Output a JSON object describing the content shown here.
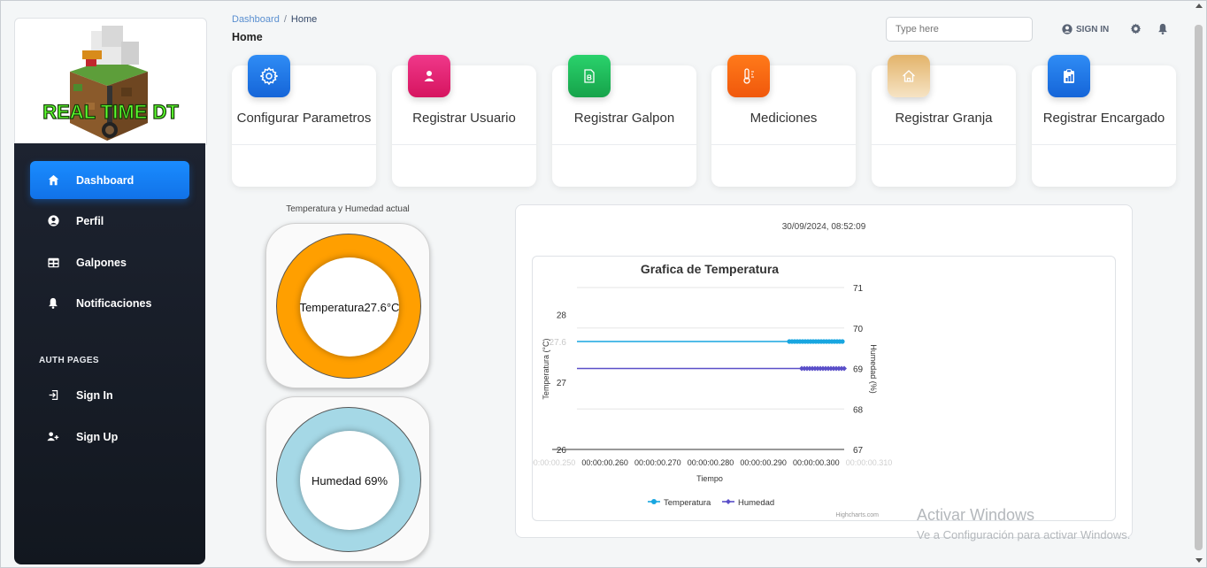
{
  "app": {
    "logo_text": "REAL TIME DT"
  },
  "breadcrumb": {
    "parent": "Dashboard",
    "separator": "/",
    "current": "Home"
  },
  "page_title": "Home",
  "search": {
    "placeholder": "Type here"
  },
  "topbar": {
    "signin_label": "SIGN IN",
    "icons": [
      "user-circle-icon",
      "gear-icon",
      "bell-icon"
    ]
  },
  "sidebar": {
    "items": [
      {
        "label": "Dashboard",
        "icon": "home-icon",
        "active": true
      },
      {
        "label": "Perfil",
        "icon": "user-circle-icon"
      },
      {
        "label": "Galpones",
        "icon": "table-icon"
      },
      {
        "label": "Notificaciones",
        "icon": "bell-icon"
      }
    ],
    "section_title": "AUTH PAGES",
    "auth_items": [
      {
        "label": "Sign In",
        "icon": "sign-in-icon"
      },
      {
        "label": "Sign Up",
        "icon": "user-plus-icon"
      }
    ]
  },
  "cards": [
    {
      "label": "Configurar Parametros",
      "icon": "gear-icon",
      "color": "#1a73e8"
    },
    {
      "label": "Registrar Usuario",
      "icon": "user-icon",
      "color": "#e91e63"
    },
    {
      "label": "Registrar Galpon",
      "icon": "document-icon",
      "color": "#1fb45a"
    },
    {
      "label": "Mediciones",
      "icon": "thermometer-icon",
      "color": "#fb6107"
    },
    {
      "label": "Registrar Granja",
      "icon": "house-icon",
      "color": "#d9a45a"
    },
    {
      "label": "Registrar Encargado",
      "icon": "clipboard-chart-icon",
      "color": "#1a73e8"
    }
  ],
  "gauges": {
    "title": "Temperatura y Humedad actual",
    "temperature_text": "Temperatura27.6°C",
    "humidity_text": "Humedad 69%",
    "temperature_color": "#ff9f00",
    "humidity_color": "#a5d8e6"
  },
  "timestamp": "30/09/2024, 08:52:09",
  "chart_data": {
    "type": "line",
    "title": "Grafica de Temperatura",
    "xlabel": "Tiempo",
    "ylabel": "Temperatura (°C)",
    "ylabel_right": "Humedad (%)",
    "x_ticks": [
      "00:00:00.250",
      "00:00:00.260",
      "00:00:00.270",
      "00:00:00.280",
      "00:00:00.290",
      "00:00:00.300",
      "00:00:00.310"
    ],
    "y_ticks_left": [
      "26",
      "27",
      "27.6",
      "28"
    ],
    "y_ticks_right": [
      "67",
      "68",
      "69",
      "70",
      "71"
    ],
    "ylim_left": [
      26,
      28.4
    ],
    "ylim_right": [
      67,
      71
    ],
    "series": [
      {
        "name": "Temperatura",
        "axis": "left",
        "color": "#18a6e0",
        "values": [
          27.6,
          27.6
        ],
        "x": [
          0.25,
          0.303
        ]
      },
      {
        "name": "Humedad",
        "axis": "right",
        "color": "#5a4fc8",
        "values": [
          69,
          69
        ],
        "x": [
          0.25,
          0.303
        ]
      }
    ],
    "credits": "Highcharts.com"
  },
  "watermark": {
    "line1": "Activar Windows",
    "line2": "Ve a Configuración para activar Windows."
  }
}
